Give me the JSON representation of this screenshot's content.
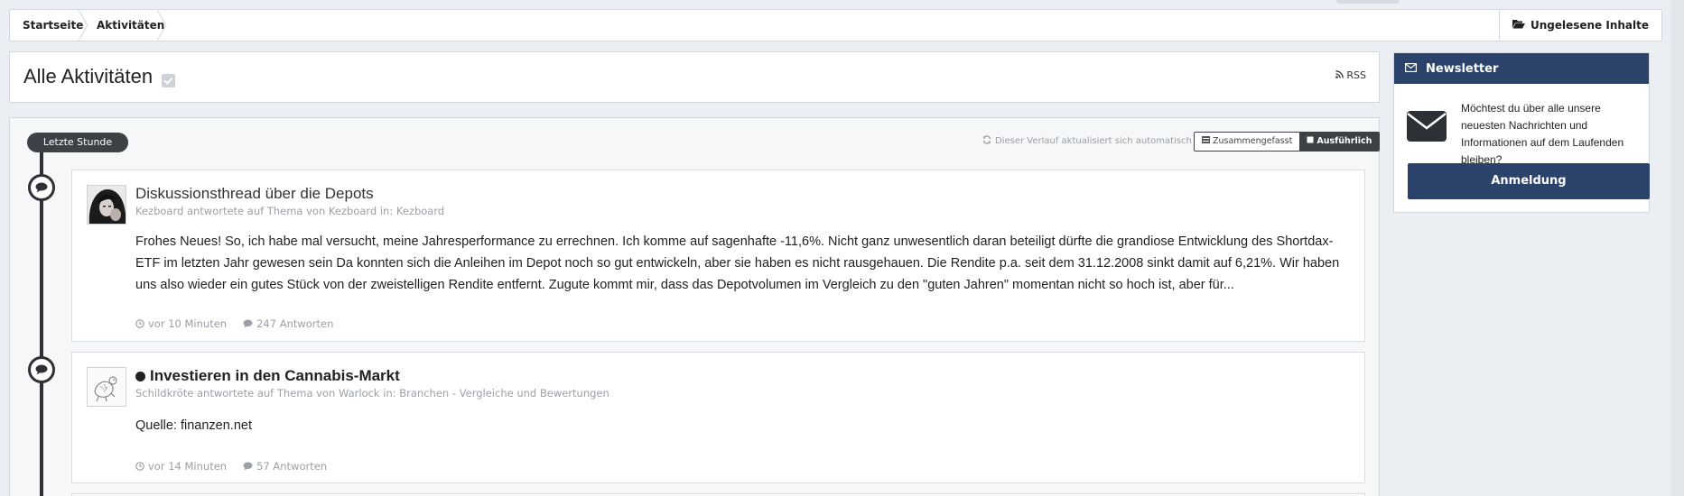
{
  "breadcrumb": {
    "items": [
      "Startseite",
      "Aktivitäten"
    ],
    "unread_label": "Ungelesene Inhalte"
  },
  "page": {
    "title": "Alle Aktivitäten",
    "rss_label": "RSS"
  },
  "stream": {
    "period_label": "Letzte Stunde",
    "auto_update_text": "Dieser Verlauf aktualisiert sich automatisch",
    "view_condensed": "Zusammengefasst",
    "view_expanded": "Ausführlich",
    "items": [
      {
        "title": "Diskussionsthread über die Depots",
        "meta": "Kezboard antwortete auf Thema von Kezboard in: Kezboard",
        "body": "Frohes Neues! So, ich habe mal versucht, meine Jahresperformance zu errechnen. Ich komme auf sagenhafte -11,6%. Nicht ganz unwesentlich daran beteiligt dürfte die grandiose Entwicklung des Shortdax-ETF im letzten Jahr gewesen sein Da konnten sich die Anleihen im Depot noch so gut entwickeln, aber sie haben es nicht rausgehauen. Die Rendite p.a. seit dem 31.12.2008 sinkt damit auf 6,21%. Wir haben uns also wieder ein gutes Stück von der zweistelligen Rendite entfernt. Zugute kommt mir, dass das Depotvolumen im Vergleich zu den \"guten Jahren\" momentan nicht so hoch ist, aber für...",
        "time": "vor 10 Minuten",
        "replies": "247 Antworten"
      },
      {
        "title": "Investieren in den Cannabis-Markt",
        "meta": "Schildkröte antwortete auf Thema von Warlock in: Branchen - Vergleiche und Bewertungen",
        "body": "Quelle: finanzen.net",
        "time": "vor 14 Minuten",
        "replies": "57 Antworten"
      }
    ]
  },
  "newsletter": {
    "header": "Newsletter",
    "text": "Möchtest du über alle unsere neuesten Nachrichten und Informationen auf dem Laufenden bleiben?",
    "button": "Anmeldung"
  },
  "colors": {
    "brand_navy": "#2b426a",
    "timeline_dark": "#2d3135"
  }
}
